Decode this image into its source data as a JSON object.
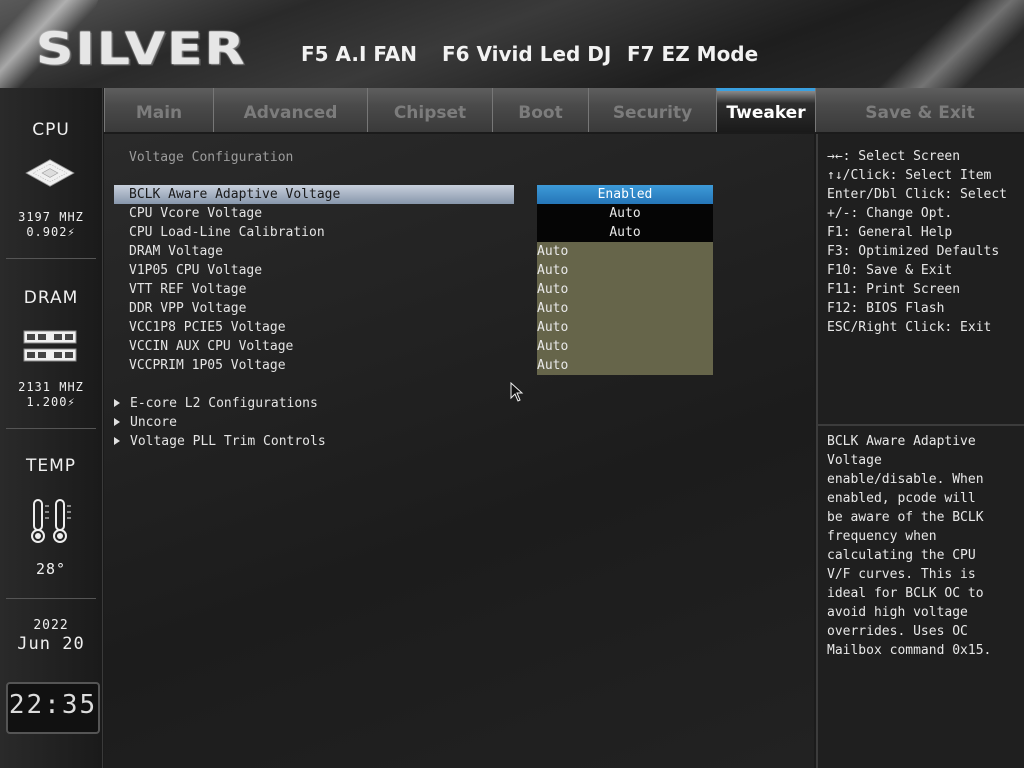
{
  "header": {
    "logo": "SILVER",
    "hotkeys": [
      "F5 A.I FAN",
      "F6 Vivid Led DJ",
      "F7 EZ Mode"
    ]
  },
  "sidebar": {
    "cpu": {
      "title": "CPU",
      "freq": "3197 MHZ",
      "volt": "0.902"
    },
    "dram": {
      "title": "DRAM",
      "freq": "2131 MHZ",
      "volt": "1.200"
    },
    "temp": {
      "title": "TEMP",
      "value": "28°"
    },
    "date": {
      "year": "2022",
      "month_day": "Jun 20"
    },
    "clock": {
      "hours": "22",
      "minutes": "35"
    }
  },
  "tabs": [
    {
      "label": "Main",
      "active": false
    },
    {
      "label": "Advanced",
      "active": false
    },
    {
      "label": "Chipset",
      "active": false
    },
    {
      "label": "Boot",
      "active": false
    },
    {
      "label": "Security",
      "active": false
    },
    {
      "label": "Tweaker",
      "active": true
    },
    {
      "label": "Save & Exit",
      "active": false
    }
  ],
  "main": {
    "section_title": "Voltage Configuration",
    "rows": [
      {
        "label": "BCLK Aware Adaptive Voltage",
        "value": "Enabled"
      },
      {
        "label": "CPU Vcore Voltage",
        "value": "Auto"
      },
      {
        "label": "CPU Load-Line Calibration",
        "value": "Auto"
      },
      {
        "label": "DRAM Voltage",
        "value": "Auto"
      },
      {
        "label": "V1P05 CPU Voltage",
        "value": "Auto"
      },
      {
        "label": "VTT REF Voltage",
        "value": "Auto"
      },
      {
        "label": "DDR VPP Voltage",
        "value": "Auto"
      },
      {
        "label": "VCC1P8 PCIE5 Voltage",
        "value": "Auto"
      },
      {
        "label": "VCCIN AUX CPU Voltage",
        "value": "Auto"
      },
      {
        "label": "VCCPRIM 1P05 Voltage",
        "value": "Auto"
      }
    ],
    "submenus": [
      "E-core L2 Configurations",
      "Uncore",
      "Voltage PLL Trim Controls"
    ]
  },
  "help": {
    "keys": [
      "→←: Select Screen",
      "↑↓/Click: Select Item",
      "Enter/Dbl Click: Select",
      "+/-: Change Opt.",
      "F1: General Help",
      "F3: Optimized Defaults",
      "F10: Save & Exit",
      "F11: Print Screen",
      "F12: BIOS Flash",
      "ESC/Right Click: Exit"
    ],
    "description": "BCLK Aware Adaptive\nVoltage\nenable/disable. When\nenabled, pcode will\nbe aware of the BCLK\nfrequency when\ncalculating the CPU\nV/F curves. This is\nideal for BCLK OC to\navoid high voltage\noverrides. Uses OC\nMailbox command 0x15."
  },
  "colors": {
    "accent_blue": "#2f86c8",
    "olive_value": "#66654a",
    "selected_row": "#a9b4c4"
  }
}
